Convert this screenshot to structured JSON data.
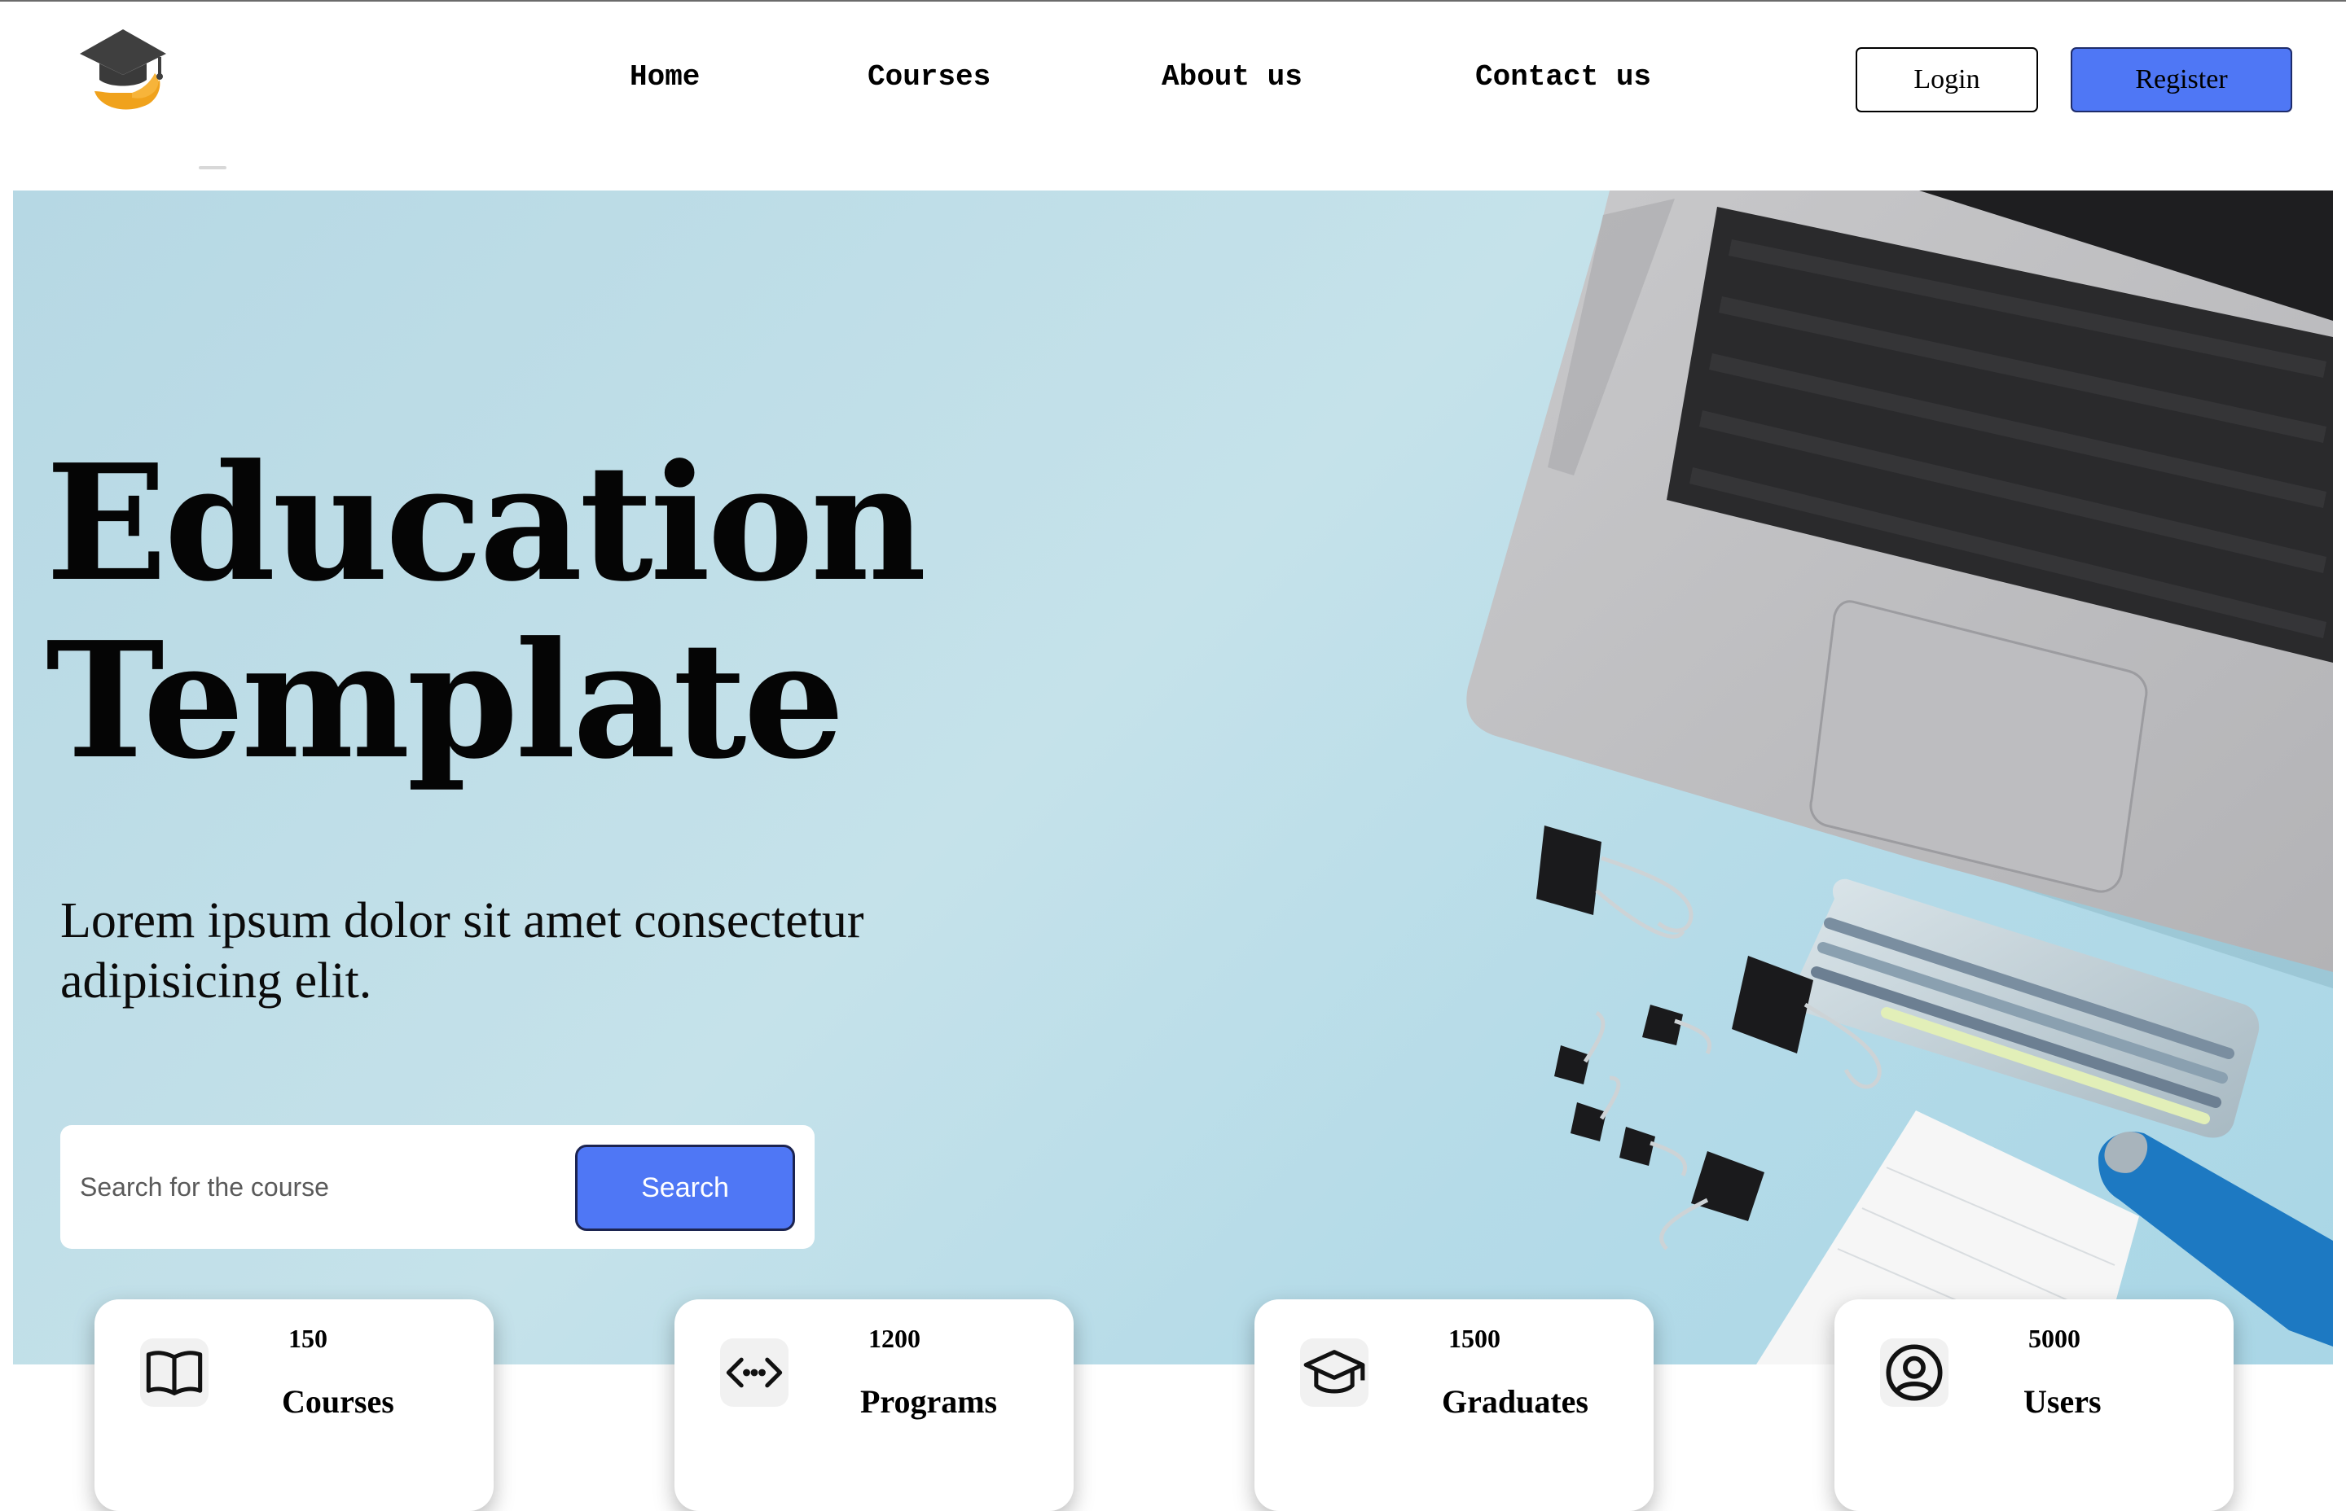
{
  "nav": {
    "links": [
      {
        "label": "Home"
      },
      {
        "label": "Courses"
      },
      {
        "label": "About us"
      },
      {
        "label": "Contact us"
      }
    ],
    "login_label": "Login",
    "register_label": "Register"
  },
  "logo": {
    "icon": "graduation-cap-hand-logo",
    "colors": {
      "cap": "#3f3f3f",
      "hand": "#f0a21c"
    }
  },
  "hero": {
    "title_line1": "Education",
    "title_line2": "Template",
    "subtitle": "Lorem ipsum dolor sit amet consectetur adipisicing elit.",
    "background_image": "laptop, binder clips, pen case, notebook and stapler on light blue desk"
  },
  "search": {
    "placeholder": "Search for the course",
    "button_label": "Search"
  },
  "stats": [
    {
      "value": "150",
      "label": "Courses",
      "icon": "book-open-icon"
    },
    {
      "value": "1200",
      "label": "Programs",
      "icon": "code-arrows-icon"
    },
    {
      "value": "1500",
      "label": "Graduates",
      "icon": "graduation-cap-icon"
    },
    {
      "value": "5000",
      "label": "Users",
      "icon": "user-circle-icon"
    }
  ],
  "colors": {
    "accent": "#4f77f5",
    "hero_bg": "#bcdde8"
  }
}
